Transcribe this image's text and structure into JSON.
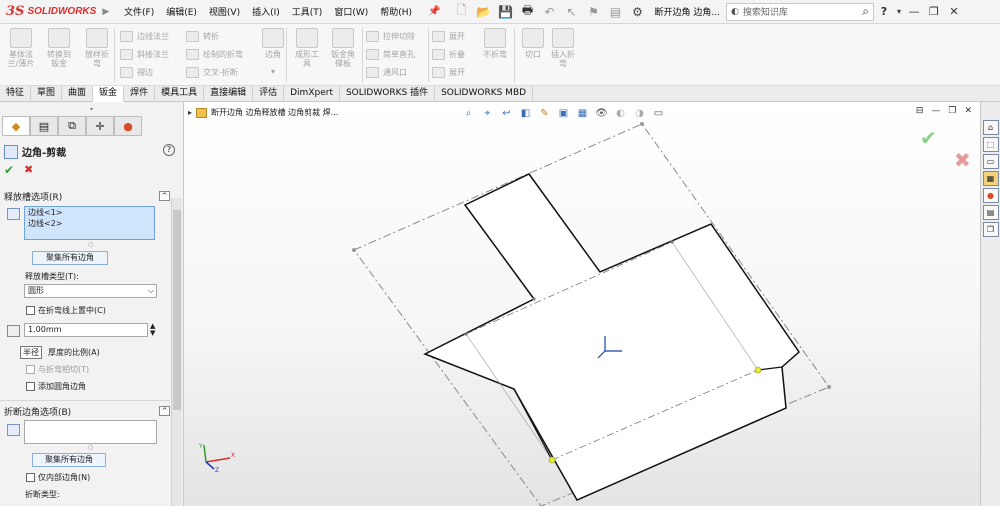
{
  "app": {
    "logo_ds": "3S",
    "logo_text": "SOLIDWORKS",
    "logo_arrow": "▶"
  },
  "menu": {
    "items": [
      "文件(F)",
      "编辑(E)",
      "视图(V)",
      "插入(I)",
      "工具(T)",
      "窗口(W)",
      "帮助(H)"
    ],
    "doc_title": "断开边角 边角...",
    "search_placeholder": "搜索知识库",
    "help_symbol": "?"
  },
  "toolbar": {
    "big_tools": [
      {
        "label": "基体法\n兰/薄片"
      },
      {
        "label": "转换到\n钣金"
      },
      {
        "label": "放样折\n弯"
      },
      {
        "label": "边角"
      },
      {
        "label": "成形工\n具"
      },
      {
        "label": "钣金角\n撑板"
      },
      {
        "label": "不折弯"
      },
      {
        "label": "切口"
      },
      {
        "label": "插入折\n弯"
      }
    ],
    "small_tools": [
      "边线法兰",
      "斜接法兰",
      "褶边",
      "转折",
      "绘制的折弯",
      "交叉-折断",
      "拉伸切除",
      "简单直孔",
      "通风口",
      "展开",
      "折叠",
      "展开"
    ]
  },
  "tabs": [
    "特征",
    "草图",
    "曲面",
    "钣金",
    "焊件",
    "模具工具",
    "直接编辑",
    "评估",
    "DimXpert",
    "SOLIDWORKS 插件",
    "SOLIDWORKS MBD"
  ],
  "active_tab": "钣金",
  "panel": {
    "title": "边角-剪裁",
    "help": "?",
    "ok": "✔",
    "cancel": "✖",
    "relief_group": {
      "header": "释放槽选项(R)",
      "edges": [
        "边线<1>",
        "边线<2>"
      ],
      "collect_button": "聚集所有边角",
      "relief_type_label": "释放槽类型(T):",
      "relief_type_value": "圆形",
      "center_on_bend": "在折弯线上置中(C)",
      "distance_value": "1.00mm",
      "ratio_label": "厚度的比例(A)",
      "tangent_label": "与折弯相切(T)",
      "fillet_label": "添加圆角边角",
      "tooltip": "半径"
    },
    "break_group": {
      "header": "折断边角选项(B)",
      "collect_button": "聚集所有边角",
      "inner_only": "仅内部边角(N)",
      "break_type_label": "折断类型:"
    }
  },
  "graphics": {
    "breadcrumb": "断开边角 边角释放槽 边角剪裁 焊...",
    "model": {
      "outline_color": "#111111",
      "construction_color": "#777777",
      "accent_point_color": "#e6ea3a"
    }
  },
  "taskpane_icons": [
    "home-icon",
    "parts-icon",
    "folder-icon",
    "view-palette-icon",
    "appearance-icon",
    "custom-props-icon",
    "forum-icon"
  ]
}
